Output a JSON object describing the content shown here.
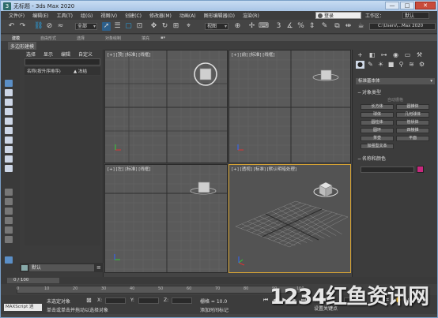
{
  "window": {
    "title": "无标题 - 3ds Max 2020",
    "buttons": [
      "—",
      "□",
      "✕"
    ]
  },
  "menubar": {
    "items": [
      "文件(F)",
      "编辑(E)",
      "工具(T)",
      "组(G)",
      "视图(V)",
      "创建(C)",
      "修改器(M)",
      "动画(A)",
      "图形编辑器(D)",
      "渲染(R)"
    ],
    "login": "登录",
    "workspace_label": "工作区：",
    "workspace_value": "默认"
  },
  "toolbar": {
    "selection_filter": "全部",
    "view_select": "视图",
    "path": "C:\\Users\\...Max 2020"
  },
  "ribbon": {
    "tabs": [
      "建模",
      "自由形式",
      "选择",
      "对象绘制",
      "填充"
    ],
    "subtab": "多边形建模"
  },
  "scene_explorer": {
    "menu": [
      "选择",
      "显示",
      "编辑",
      "自定义"
    ],
    "col_name": "名称(按升序排序)",
    "col_freeze": "▲ 冻结",
    "layer": "默认"
  },
  "viewports": {
    "top": "[+] [顶] [标准] [线框]",
    "front": "[+] [前] [标准] [线框]",
    "left": "[+] [左] [标准] [线框]",
    "perspective": "[+] [透视] [标准] [默认明暗处理]"
  },
  "command_panel": {
    "category": "标准基本体",
    "section_object_type": "对象类型",
    "auto_grid": "自动栅格",
    "objects": [
      "长方体",
      "圆锥体",
      "球体",
      "几何球体",
      "圆柱体",
      "管状体",
      "圆环",
      "四棱锥",
      "茶壶",
      "平面",
      "加强型文本"
    ],
    "section_name_color": "名称和颜色",
    "color": "#c8287e"
  },
  "timeline": {
    "frame": "0 / 100",
    "ticks": [
      "0",
      "10",
      "20",
      "30",
      "40",
      "50",
      "60",
      "70",
      "80",
      "90",
      "100"
    ]
  },
  "statusbar": {
    "maxscript": "MAXScript 迷",
    "selection": "未选定对象",
    "prompt": "单击或单击并拖动以选择对象",
    "x_label": "X:",
    "y_label": "Y:",
    "z_label": "Z:",
    "grid_label": "栅格 = 10.0",
    "add_tag": "添加时间标记",
    "auto_key": "自动",
    "set_key": "设置关键点"
  },
  "watermark": "1234红鱼资讯网"
}
